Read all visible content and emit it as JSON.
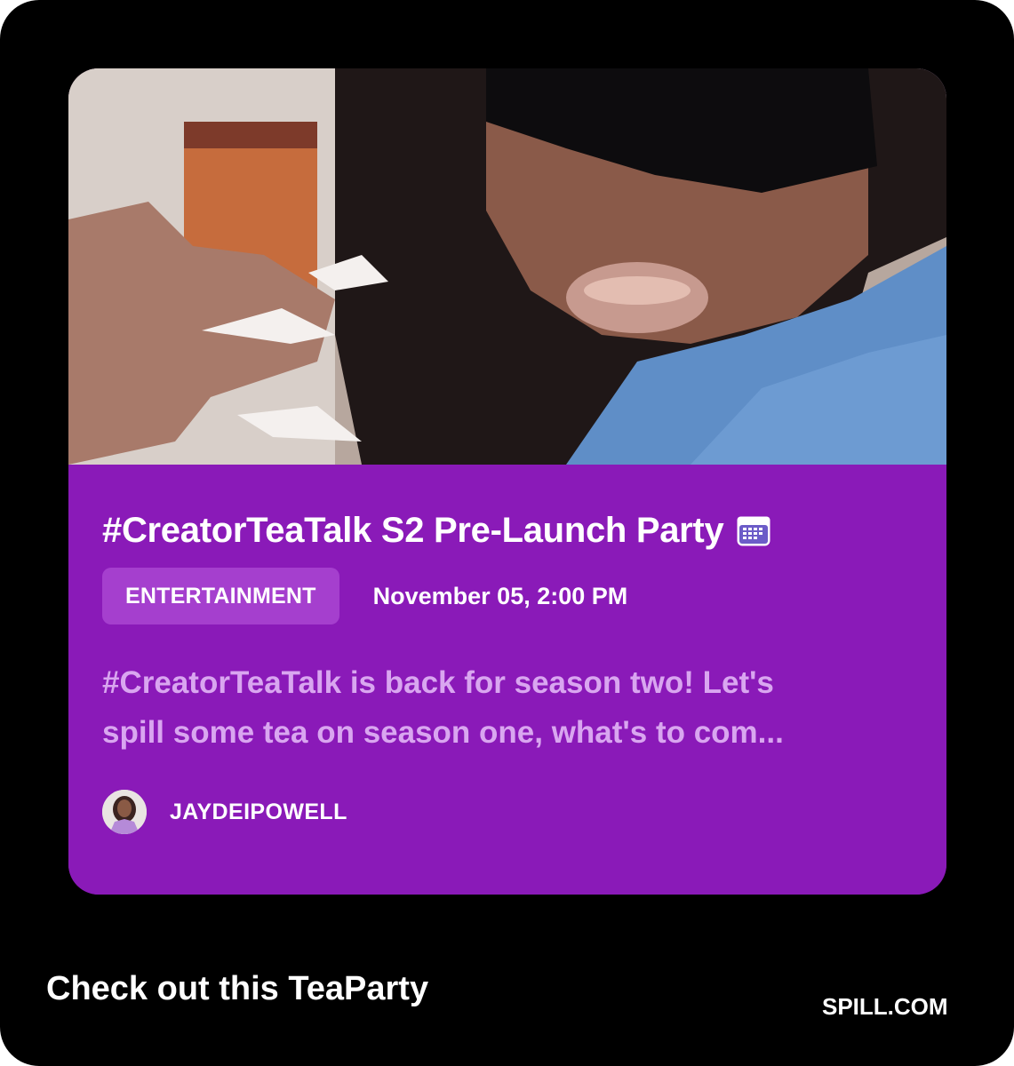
{
  "event": {
    "title": "#CreatorTeaTalk S2 Pre-Launch Party",
    "title_icon": "calendar-icon",
    "category": "ENTERTAINMENT",
    "datetime": "November 05, 2:00 PM",
    "description_line1": "#CreatorTeaTalk is back for season two! Let's",
    "description_line2": "spill some tea on season one, what's to com...",
    "author": "JAYDEIPOWELL",
    "image": "photo of person in sunglasses holding a drink"
  },
  "footer": {
    "caption": "Check out this TeaParty",
    "brand": "SPILL.COM"
  },
  "colors": {
    "background": "#000000",
    "card": "#8a1ab8",
    "badge": "#a53fce",
    "description": "#d9a6f0",
    "text": "#ffffff"
  }
}
